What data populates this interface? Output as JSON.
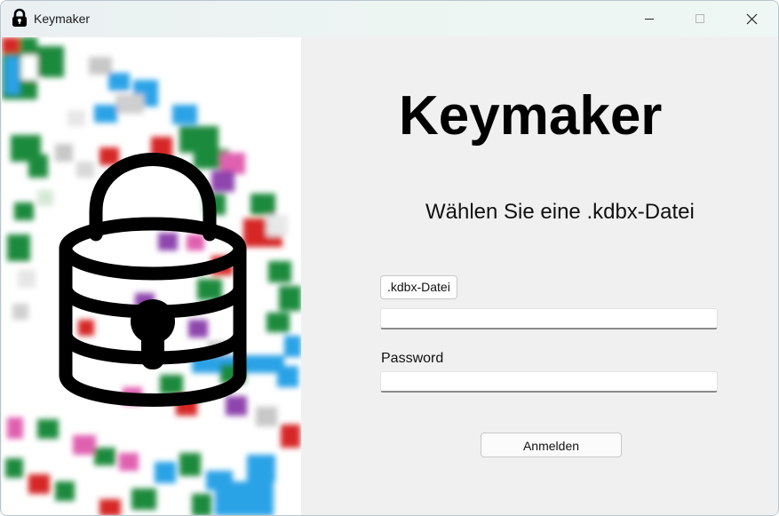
{
  "window": {
    "title": "Keymaker",
    "icon": "padlock-icon",
    "controls": [
      "minimize-icon",
      "maximize-icon",
      "close-icon"
    ]
  },
  "main": {
    "app_title": "Keymaker",
    "subtitle": "Wählen Sie eine .kdbx-Datei",
    "file_button_label": ".kdbx-Datei",
    "file_path_value": "",
    "password_label": "Password",
    "password_value": "",
    "login_button_label": "Anmelden"
  },
  "art": {
    "icon": "database-lock-icon",
    "colors": [
      "#1f8a3c",
      "#2ba3e6",
      "#d62828",
      "#8e44ad",
      "#e060b0",
      "#c8c8c8"
    ]
  }
}
